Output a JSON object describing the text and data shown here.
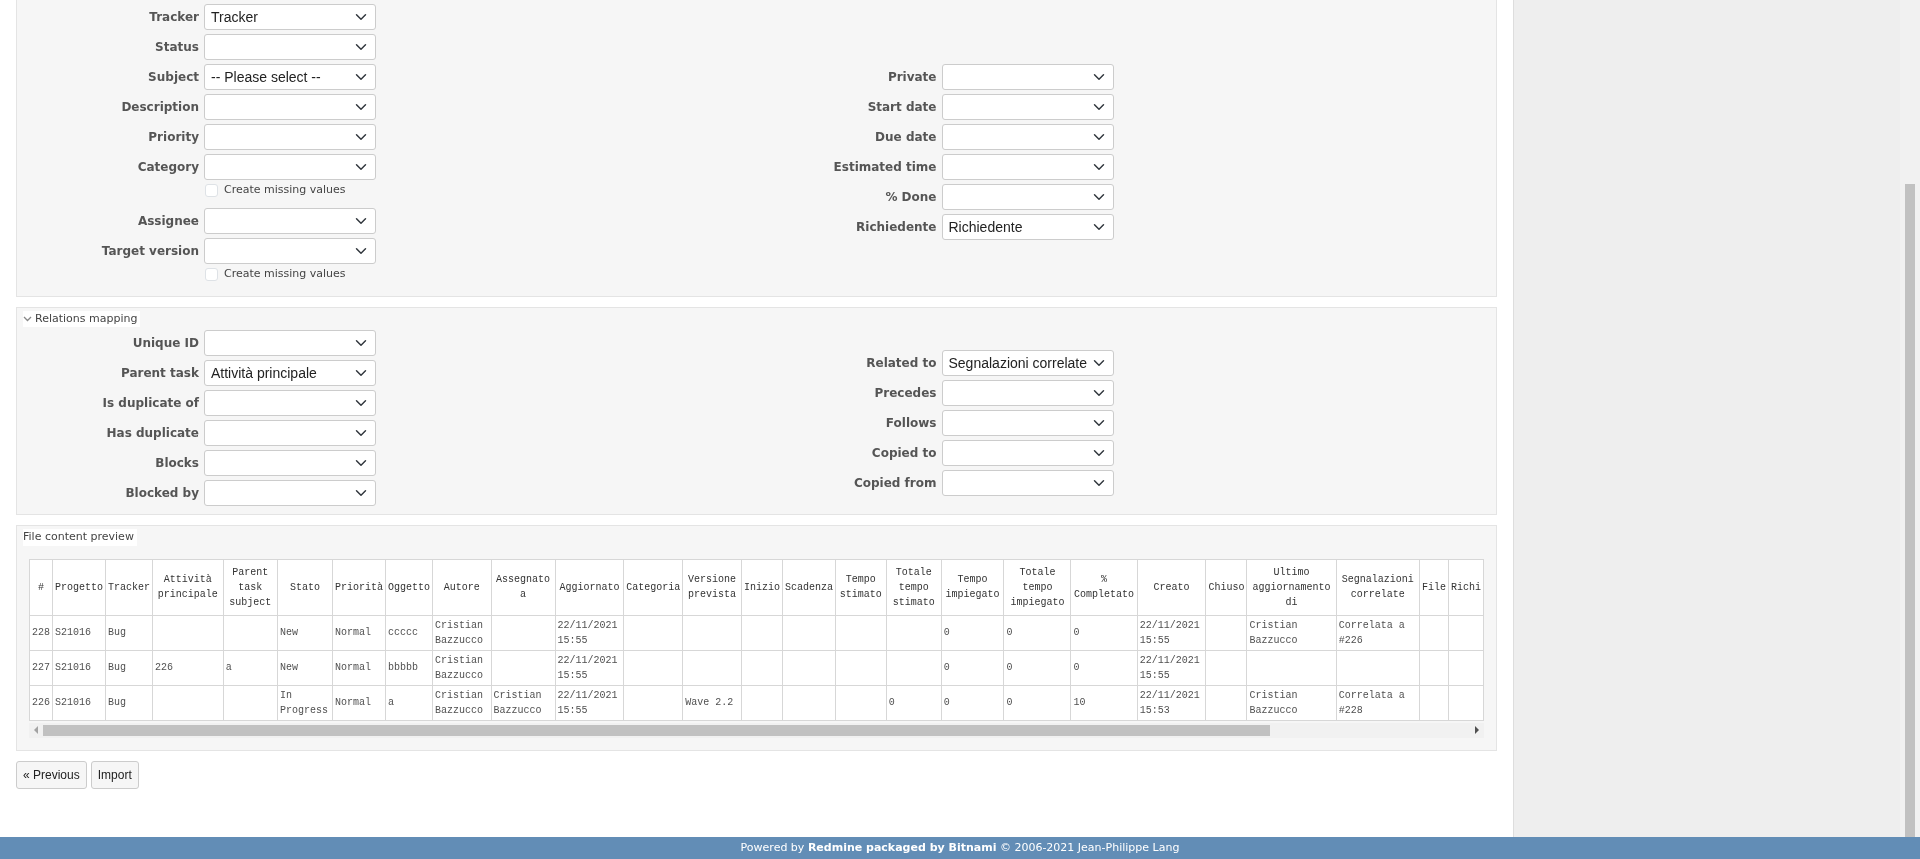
{
  "sections": [
    {
      "left_fields": [
        {
          "kind": "select",
          "label": "Tracker",
          "value": "Tracker"
        },
        {
          "kind": "select",
          "label": "Status"
        },
        {
          "kind": "select",
          "label": "Subject",
          "value": "-- Please select --"
        },
        {
          "kind": "select",
          "label": "Description"
        },
        {
          "kind": "select",
          "label": "Priority"
        },
        {
          "kind": "select",
          "label": "Category"
        },
        {
          "kind": "checkbox",
          "label": "Create missing values",
          "checked": false
        },
        {
          "kind": "select",
          "label": "Assignee"
        },
        {
          "kind": "select",
          "label": "Target version"
        },
        {
          "kind": "checkbox",
          "label": "Create missing values",
          "checked": false
        }
      ],
      "right_fields": [
        {
          "kind": "select",
          "label": "Private"
        },
        {
          "kind": "select",
          "label": "Start date"
        },
        {
          "kind": "select",
          "label": "Due date"
        },
        {
          "kind": "select",
          "label": "Estimated time"
        },
        {
          "kind": "select",
          "label": "% Done"
        },
        {
          "kind": "select",
          "label": "Richiedente",
          "value": "Richiedente"
        }
      ]
    },
    {
      "legend": "Relations mapping",
      "collapsible": true,
      "left_fields": [
        {
          "kind": "select",
          "label": "Unique ID"
        },
        {
          "kind": "select",
          "label": "Parent task",
          "value": "Attività principale"
        },
        {
          "kind": "select",
          "label": "Is duplicate of"
        },
        {
          "kind": "select",
          "label": "Has duplicate"
        },
        {
          "kind": "select",
          "label": "Blocks"
        },
        {
          "kind": "select",
          "label": "Blocked by"
        }
      ],
      "right_fields": [
        {
          "kind": "select",
          "label": "Related to",
          "value": "Segnalazioni correlate"
        },
        {
          "kind": "select",
          "label": "Precedes"
        },
        {
          "kind": "select",
          "label": "Follows"
        },
        {
          "kind": "select",
          "label": "Copied to"
        },
        {
          "kind": "select",
          "label": "Copied from"
        }
      ]
    }
  ],
  "preview": {
    "legend": "File content preview",
    "columns": [
      "#",
      "Progetto",
      "Tracker",
      "Attività principale",
      "Parent task subject",
      "Stato",
      "Priorità",
      "Oggetto",
      "Autore",
      "Assegnato a",
      "Aggiornato",
      "Categoria",
      "Versione prevista",
      "Inizio",
      "Scadenza",
      "Tempo stimato",
      "Totale tempo stimato",
      "Tempo impiegato",
      "Totale tempo impiegato",
      "% Completato",
      "Creato",
      "Chiuso",
      "Ultimo aggiornamento di",
      "Segnalazioni correlate",
      "File",
      "Richi"
    ],
    "rows": [
      [
        "228",
        "S21016",
        "Bug",
        null,
        null,
        "New",
        "Normal",
        "ccccc",
        "Cristian Bazzucco",
        null,
        "22/11/2021 15:55",
        null,
        null,
        null,
        null,
        null,
        null,
        "0",
        "0",
        "0",
        "22/11/2021 15:55",
        null,
        "Cristian Bazzucco",
        "Correlata a #226",
        null,
        null
      ],
      [
        "227",
        "S21016",
        "Bug",
        "226",
        "a",
        "New",
        "Normal",
        "bbbbb",
        "Cristian Bazzucco",
        null,
        "22/11/2021 15:55",
        null,
        null,
        null,
        null,
        null,
        null,
        "0",
        "0",
        "0",
        "22/11/2021 15:55",
        null,
        null,
        null,
        null,
        null
      ],
      [
        "226",
        "S21016",
        "Bug",
        null,
        null,
        "In Progress",
        "Normal",
        "a",
        "Cristian Bazzucco",
        "Cristian Bazzucco",
        "22/11/2021 15:55",
        null,
        "Wave 2.2",
        null,
        null,
        null,
        "0",
        "0",
        "0",
        "10",
        "22/11/2021 15:53",
        null,
        "Cristian Bazzucco",
        "Correlata a #228",
        null,
        null
      ]
    ]
  },
  "buttons": [
    "« Previous",
    "Import"
  ],
  "footer": "Powered by **Redmine packaged by Bitnami** © 2006-2021 Jean-Philippe Lang"
}
